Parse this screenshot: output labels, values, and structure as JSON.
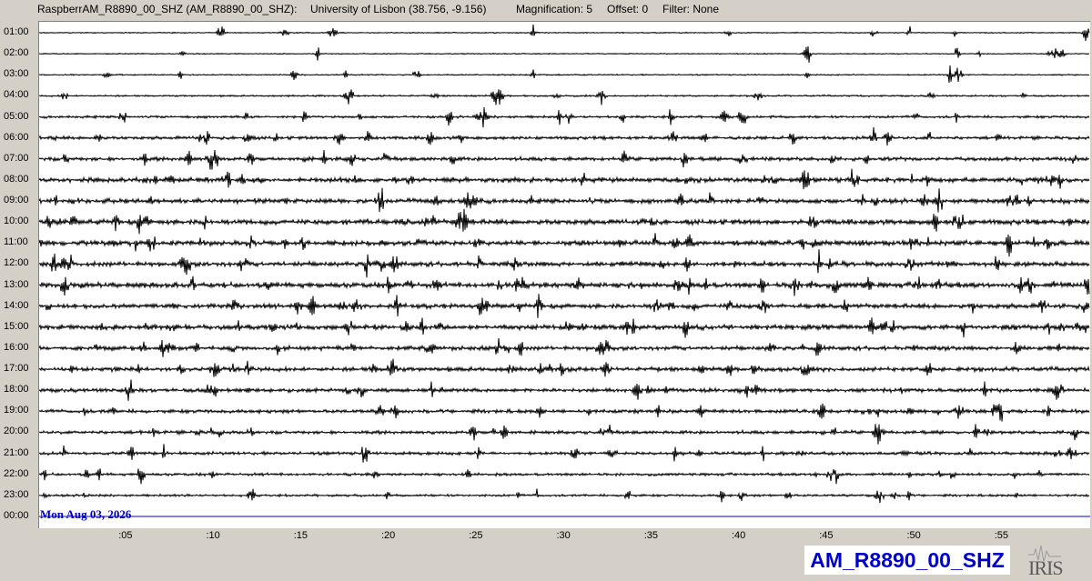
{
  "header": {
    "station_title": "RaspberrAM_R8890_00_SHZ (AM_R8890_00_SHZ):",
    "location": "University of Lisbon (38.756, -9.156)",
    "magnification": "Magnification: 5",
    "offset": "Offset: 0",
    "filter": "Filter: None"
  },
  "chart_data": {
    "type": "helicorder",
    "title": "RaspberrAM_R8890_00_SHZ (AM_R8890_00_SHZ)",
    "date": "Mon Aug 03, 2026",
    "y_labels": [
      "01:00",
      "02:00",
      "03:00",
      "04:00",
      "05:00",
      "06:00",
      "07:00",
      "08:00",
      "09:00",
      "10:00",
      "11:00",
      "12:00",
      "13:00",
      "14:00",
      "15:00",
      "16:00",
      "17:00",
      "18:00",
      "19:00",
      "20:00",
      "21:00",
      "22:00",
      "23:00",
      "00:00"
    ],
    "x_tick_labels": [
      ":05",
      ":10",
      ":15",
      ":20",
      ":25",
      ":30",
      ":35",
      ":40",
      ":45",
      ":50",
      ":55"
    ],
    "x_range_minutes": [
      0,
      60
    ],
    "trace_noise_level": [
      0.5,
      0.5,
      0.6,
      0.8,
      1.2,
      1.5,
      1.8,
      2.2,
      2.2,
      2.4,
      2.4,
      2.3,
      2.5,
      2.2,
      2.3,
      2.0,
      2.0,
      1.8,
      1.7,
      1.6,
      1.5,
      1.3,
      1.1,
      0
    ],
    "trace_color": "#000000",
    "last_line_color": "#0000cc",
    "grid": false
  },
  "station_badge": "AM_R8890_00_SHZ",
  "logo": "IRIS"
}
